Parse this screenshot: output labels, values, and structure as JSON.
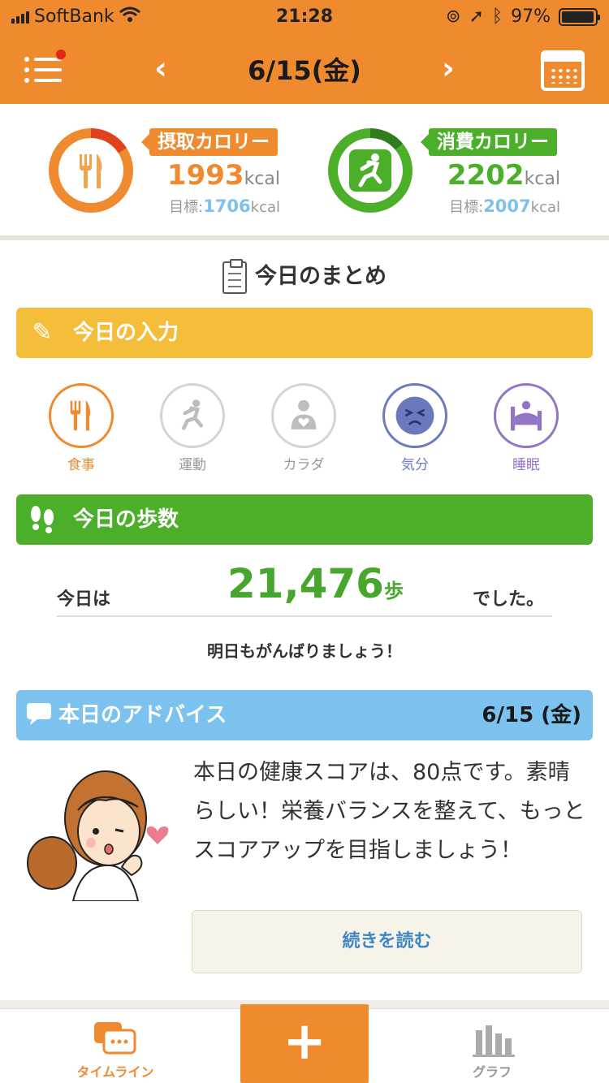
{
  "status": {
    "carrier": "SoftBank",
    "time": "21:28",
    "battery": "97%",
    "battery_level": 0.97
  },
  "header": {
    "date": "6/15(金)",
    "prev_arrow": "‹",
    "next_arrow": "›",
    "accent": "#f08a2e",
    "menu_icon": "hamburger-menu-icon",
    "calendar_icon": "calendar-icon"
  },
  "calories": {
    "intake": {
      "label": "摂取カロリー",
      "value": "1993",
      "unit": "kcal",
      "goal_label": "目標:",
      "goal": "1706",
      "goal_unit": "kcal",
      "color": "#f08a2e",
      "icon": "fork-knife-icon"
    },
    "burn": {
      "label": "消費カロリー",
      "value": "2202",
      "unit": "kcal",
      "goal_label": "目標:",
      "goal": "2007",
      "goal_unit": "kcal",
      "color": "#4caf2a",
      "icon": "running-person-icon"
    }
  },
  "summary": {
    "title": "今日のまとめ",
    "icon": "clipboard-icon"
  },
  "input": {
    "title": "今日の入力",
    "color": "#f4be3a",
    "icon": "pencil-icon",
    "items": [
      {
        "label": "食事",
        "icon": "fork-knife-icon",
        "color": "#f08a2e"
      },
      {
        "label": "運動",
        "icon": "running-person-icon",
        "color": "#bdbdbd"
      },
      {
        "label": "カラダ",
        "icon": "body-heart-icon",
        "color": "#bdbdbd"
      },
      {
        "label": "気分",
        "icon": "mood-face-icon",
        "color": "#6b7abf"
      },
      {
        "label": "睡眠",
        "icon": "bed-icon",
        "color": "#9474c4"
      }
    ]
  },
  "steps": {
    "title": "今日の歩数",
    "color": "#4caf2a",
    "icon": "footprints-icon",
    "prefix": "今日は",
    "value": "21,476",
    "unit": "歩",
    "suffix": "でした。",
    "message": "明日もがんばりましょう！"
  },
  "advice": {
    "title": "本日のアドバイス",
    "date": "6/15 (金)",
    "color": "#7cc2ef",
    "icon": "speech-bubble-icon",
    "text": "本日の健康スコアは、80点です。素晴らしい！栄養バランスを整えて、もっとスコアアップを目指しましょう！",
    "read_more": "続きを読む"
  },
  "tabbar": {
    "timeline": "タイムライン",
    "add": "+",
    "graph": "グラフ"
  }
}
